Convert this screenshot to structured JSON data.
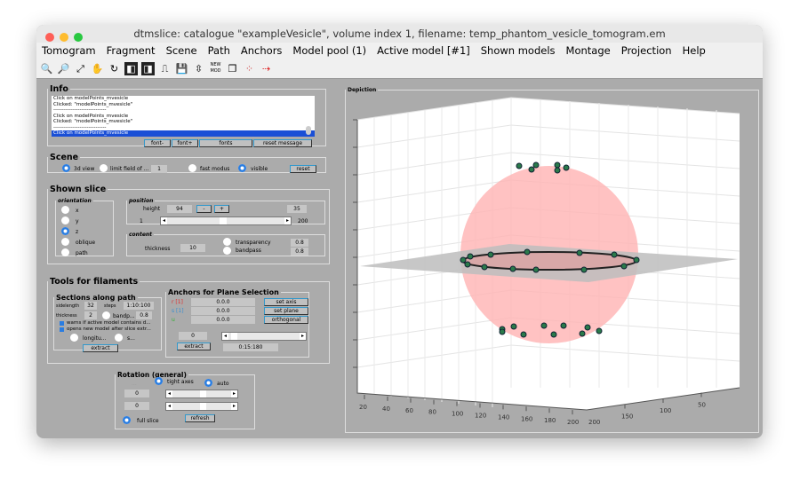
{
  "window": {
    "title": "dtmslice: catalogue \"exampleVesicle\", volume index 1, filename: temp_phantom_vesicle_tomogram.em"
  },
  "menu": [
    "Tomogram",
    "Fragment",
    "Scene",
    "Path",
    "Anchors",
    "Model pool (1)",
    "Active model [#1]",
    "Shown models",
    "Montage",
    "Projection",
    "Help"
  ],
  "toolbar": {
    "icons": [
      "zoom-in-icon",
      "zoom-out-icon",
      "fit-icon",
      "hand-icon",
      "rotate-icon",
      "slice-a-icon",
      "slice-b-icon",
      "pulse-icon",
      "save-icon",
      "center-icon",
      "new-model-icon",
      "copy-icon",
      "nodes-icon",
      "transfer-icon"
    ],
    "new_mod": "NEW MOD"
  },
  "info": {
    "title": "Info",
    "lines": [
      "Click on modelPoints_mvesicle",
      "Clicked: \"modelPoints_mvesicle\"",
      "------------------------------",
      "Click on modelPoints_mvesicle",
      "Clicked: \"modelPoints_mvesicle\"",
      "------------------------------",
      "Click on modelPoints_mvesicle"
    ],
    "buttons": [
      "font-",
      "font+",
      "fonts",
      "reset message"
    ]
  },
  "scene": {
    "title": "Scene",
    "view3d": "3d view",
    "limit": "limit field of ...",
    "limit_value": "1",
    "fast": "fast modus",
    "visible": "visible",
    "reset": "reset"
  },
  "slice": {
    "title": "Shown slice",
    "orientation_title": "orientation",
    "orientations": [
      "x",
      "y",
      "z",
      "oblique",
      "path"
    ],
    "selected": "z",
    "position_title": "position",
    "height_label": "height",
    "height": "94",
    "minus": "-",
    "plus": "+",
    "pos_value": "35",
    "slider_min": "1",
    "slider_max": "200",
    "slider_level": 0.48,
    "content_title": "content",
    "thickness_label": "thickness",
    "thickness": "10",
    "transparency": "transparency",
    "transparency_value": "0.8",
    "bandpass": "bandpass",
    "bandpass_value": "0.8"
  },
  "filaments": {
    "title": "Tools for filaments",
    "sections_title": "Sections along path",
    "sidelength_label": "sidelength",
    "sidelength": "32",
    "steps_label": "steps",
    "steps": "1:10:100",
    "thickness_label": "thickness",
    "thickness": "2",
    "bandpass": "bandp...",
    "bandpass_value": "0.8",
    "warn": "warns if active model contains d...",
    "opens": "opens new model after slice extr...",
    "longitu": "longitu...",
    "s": "s...",
    "extract": "extract",
    "anchors_title": "Anchors for Plane Selection",
    "anchors": [
      {
        "label": "r [1]",
        "value": "0.0.0",
        "color": "#e03030",
        "button": "set axis"
      },
      {
        "label": "s [1]",
        "value": "0.0.0",
        "color": "#3a8fd0",
        "button": "set plane"
      },
      {
        "label": "u",
        "value": "0.0.0",
        "color": "#30b030",
        "button": "orthogonal"
      }
    ],
    "angle": "0",
    "range": "0:15:180"
  },
  "rotation": {
    "title": "Rotation (general)",
    "dots": "...",
    "tight": "tight axes",
    "auto": "auto",
    "v1": "0",
    "v2": "0",
    "full": "full slice",
    "refresh": "refresh"
  },
  "depiction": {
    "title": "Depiction",
    "x_ticks": [
      "20",
      "40",
      "60",
      "80",
      "100",
      "120",
      "140",
      "160",
      "180",
      "200"
    ],
    "y_ticks": [
      "200",
      "150",
      "100",
      "50"
    ],
    "sphere_color": "#ffb3b3",
    "point_color": "#2a7a4a"
  }
}
